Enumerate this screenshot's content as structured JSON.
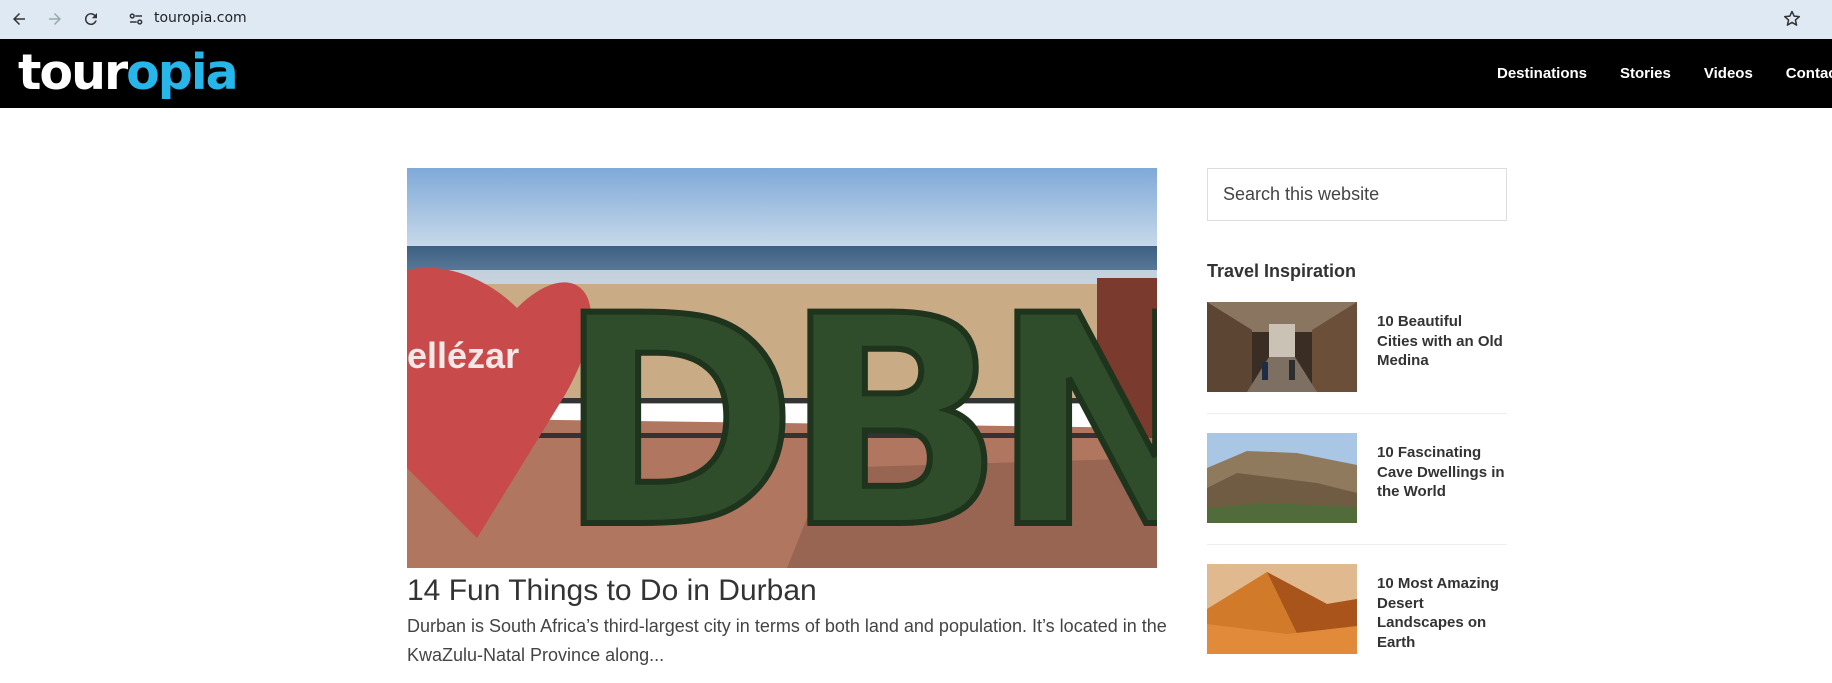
{
  "browser": {
    "url": "touropia.com",
    "icons": [
      "back-icon",
      "forward-icon",
      "reload-icon",
      "site-settings-icon",
      "bookmark-star-icon"
    ]
  },
  "header": {
    "logo_part1": "tour",
    "logo_part2": "opia",
    "nav": [
      "Destinations",
      "Stories",
      "Videos",
      "Contact"
    ],
    "colors": {
      "background": "#000000",
      "logo_accent": "#27b6ea"
    }
  },
  "main": {
    "featured_post": {
      "image_sign_text": "ellézar",
      "image_letters": "DBN",
      "title": "14 Fun Things to Do in Durban",
      "excerpt": "Durban is South Africa’s third-largest city in terms of both land and population. It’s located in the KwaZulu-Natal Province along..."
    }
  },
  "sidebar": {
    "search": {
      "placeholder": "Search this website"
    },
    "widget_title": "Travel Inspiration",
    "items": [
      {
        "title": "10 Beautiful Cities with an Old Medina"
      },
      {
        "title": "10 Fascinating Cave Dwellings in the World"
      },
      {
        "title": "10 Most Amazing Desert Landscapes on Earth"
      }
    ]
  }
}
